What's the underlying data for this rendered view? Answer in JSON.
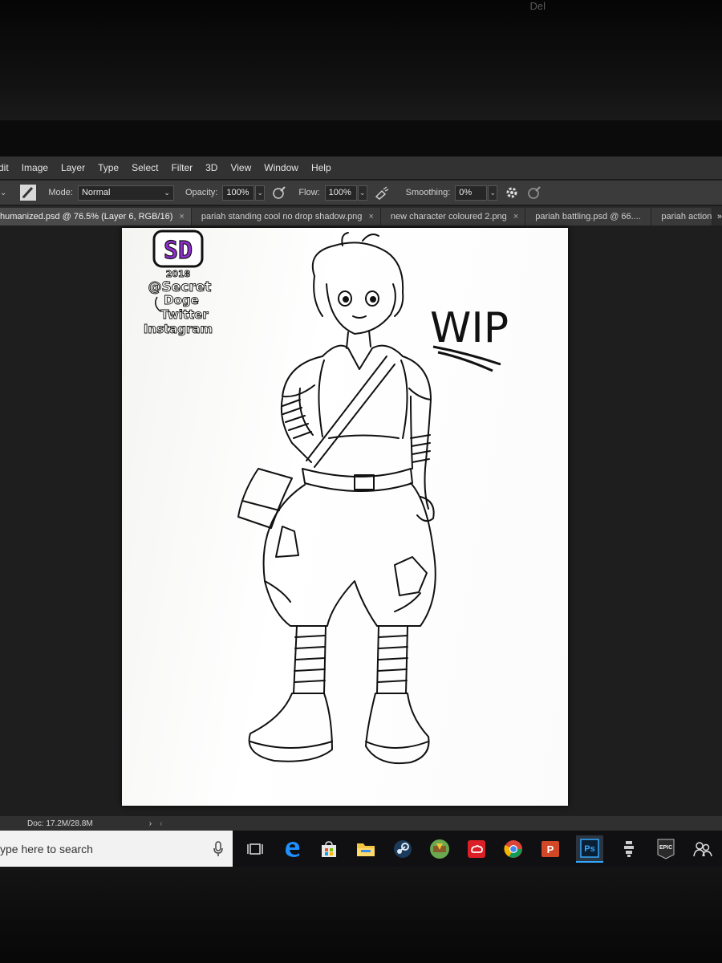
{
  "menu": {
    "items": [
      "dit",
      "Image",
      "Layer",
      "Type",
      "Select",
      "Filter",
      "3D",
      "View",
      "Window",
      "Help"
    ]
  },
  "options": {
    "mode_label": "Mode:",
    "mode_value": "Normal",
    "opacity_label": "Opacity:",
    "opacity_value": "100%",
    "flow_label": "Flow:",
    "flow_value": "100%",
    "smoothing_label": "Smoothing:",
    "smoothing_value": "0%"
  },
  "tabs": [
    {
      "label": "humanized.psd @ 76.5% (Layer 6, RGB/16)",
      "active": true
    },
    {
      "label": "pariah standing cool no drop shadow.png"
    },
    {
      "label": "new character coloured 2.png"
    },
    {
      "label": "pariah battling.psd @ 66...."
    },
    {
      "label": "pariah action"
    }
  ],
  "tab_close": "×",
  "tab_overflow": "»",
  "canvas": {
    "logo_letters": "SD",
    "watermark_lines": [
      "2018",
      "@Secret",
      "Doge",
      "Twitter",
      "Instagram"
    ],
    "wip_text": "WIP"
  },
  "status": {
    "doc": "Doc: 17.2M/28.8M",
    "arrow": "›",
    "scroll": "‹"
  },
  "taskbar": {
    "search_placeholder": "ype here to search",
    "apps": [
      "task-view-icon",
      "edge-icon",
      "store-icon",
      "file-explorer-icon",
      "steam-icon",
      "minecraft-icon",
      "creative-cloud-icon",
      "chrome-icon",
      "powerpoint-icon",
      "photoshop-icon",
      "app-icon",
      "epic-games-icon",
      "people-icon"
    ],
    "ps_label": "Ps",
    "epic_label": "EPIC"
  },
  "bezel": {
    "brand": "Del"
  },
  "colors": {
    "ps_blue": "#31a8ff",
    "logo_purple": "#8f2fd0",
    "chrome_red": "#db4437",
    "ppt_orange": "#d24726"
  }
}
